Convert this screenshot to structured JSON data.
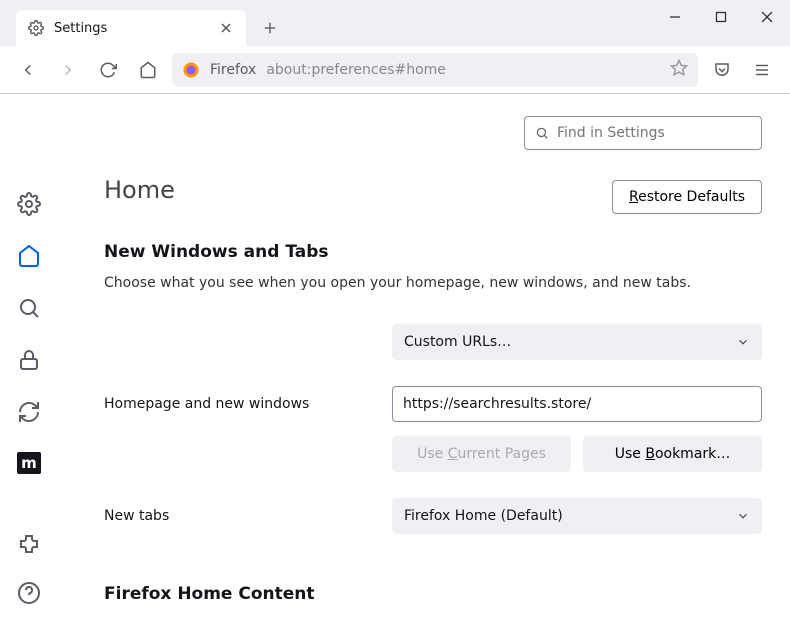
{
  "tab": {
    "title": "Settings"
  },
  "url": {
    "label": "Firefox",
    "address": "about:preferences#home"
  },
  "search": {
    "placeholder": "Find in Settings"
  },
  "page": {
    "title": "Home"
  },
  "restore": {
    "prefix": "R",
    "rest": "estore Defaults"
  },
  "section1": {
    "heading": "New Windows and Tabs",
    "desc": "Choose what you see when you open your homepage, new windows, and new tabs."
  },
  "homepage": {
    "label": "Homepage and new windows",
    "selectValue": "Custom URLs…",
    "urlValue": "https://searchresults.store/",
    "useCurrent_pre": "Use ",
    "useCurrent_ul": "C",
    "useCurrent_post": "urrent Pages",
    "useBookmark_pre": "Use ",
    "useBookmark_ul": "B",
    "useBookmark_post": "ookmark…"
  },
  "newtabs": {
    "label": "New tabs",
    "selectValue": "Firefox Home (Default)"
  },
  "section2": {
    "heading": "Firefox Home Content"
  }
}
